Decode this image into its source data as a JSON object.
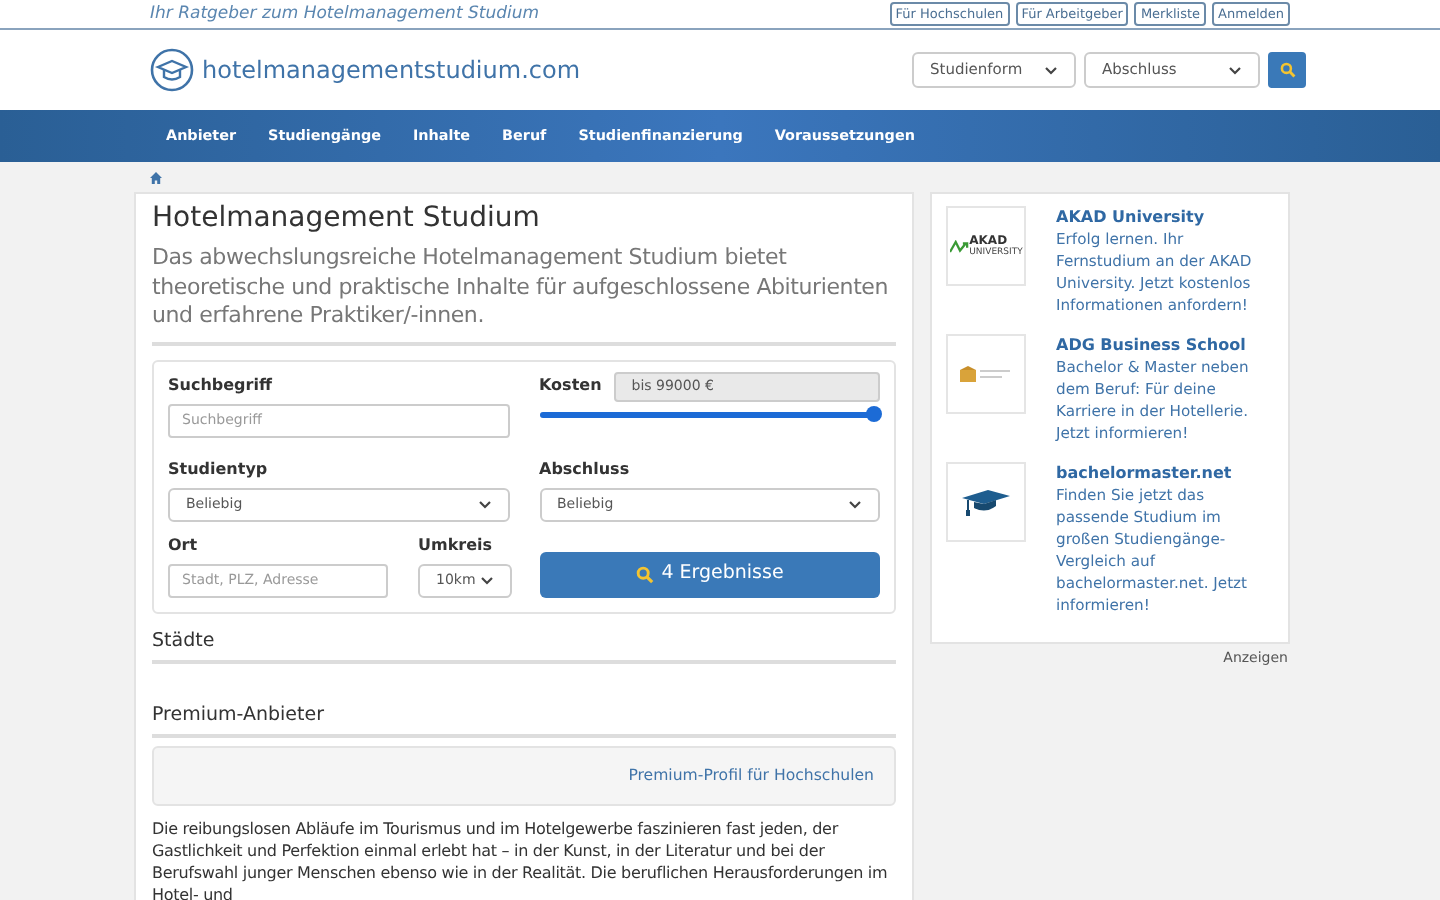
{
  "tagline": "Ihr Ratgeber zum Hotelmanagement Studium",
  "top_links": [
    "Für Hochschulen",
    "Für Arbeitgeber",
    "Merkliste",
    "Anmelden"
  ],
  "logo": {
    "text": "hotelmanagementstudium.com"
  },
  "header_filters": [
    {
      "label": "Studienform"
    },
    {
      "label": "Abschluss"
    }
  ],
  "nav": [
    "Anbieter",
    "Studiengänge",
    "Inhalte",
    "Beruf",
    "Studienfinanzierung",
    "Voraussetzungen"
  ],
  "page": {
    "title": "Hotelmanagement Studium",
    "lead": "Das abwechslungsreiche Hotelmanagement Studium bietet theoretische und praktische Inhalte für aufgeschlossene Abiturienten und erfahrene Praktiker/-innen."
  },
  "search_form": {
    "keyword": {
      "label": "Suchbegriff",
      "placeholder": "Suchbegriff"
    },
    "cost": {
      "label": "Kosten",
      "value": "bis 99000 €",
      "level": 1
    },
    "study_type": {
      "label": "Studientyp",
      "value": "Beliebig"
    },
    "degree": {
      "label": "Abschluss",
      "value": "Beliebig"
    },
    "location": {
      "label": "Ort",
      "placeholder": "Stadt, PLZ, Adresse"
    },
    "radius": {
      "label": "Umkreis",
      "value": "10km"
    },
    "submit": "4 Ergebnisse"
  },
  "sections": [
    {
      "heading": "Städte"
    },
    {
      "heading": "Premium-Anbieter",
      "link": "Premium-Profil für Hochschulen"
    }
  ],
  "body_text": "Die reibungslosen Abläufe im Tourismus und im Hotelgewerbe faszinieren fast jeden, der Gastlichkeit und Perfektion einmal erlebt hat – in der Kunst, in der Literatur und bei der Berufswahl junger Menschen ebenso wie in der Realität. Die beruflichen Herausforderungen im Hotel- und",
  "ads": [
    {
      "kind": "akad",
      "logo_text": [
        "AKAD",
        "UNIVERSITY"
      ],
      "title": "AKAD University",
      "text": "Erfolg lernen. Ihr Fernstudium an der AKAD University. Jetzt kostenlos Informationen anfordern!"
    },
    {
      "kind": "adg",
      "title": "ADG Business School",
      "text": "Bachelor & Master neben dem Beruf: Für deine Karriere in der Hotellerie. Jetzt informieren!"
    },
    {
      "kind": "cap",
      "title": "bachelormaster.net",
      "text": "Finden Sie jetzt das passende Studium im großen Studiengänge-Vergleich auf bachelormaster.net. Jetzt informieren!"
    }
  ],
  "ads_label": "Anzeigen"
}
